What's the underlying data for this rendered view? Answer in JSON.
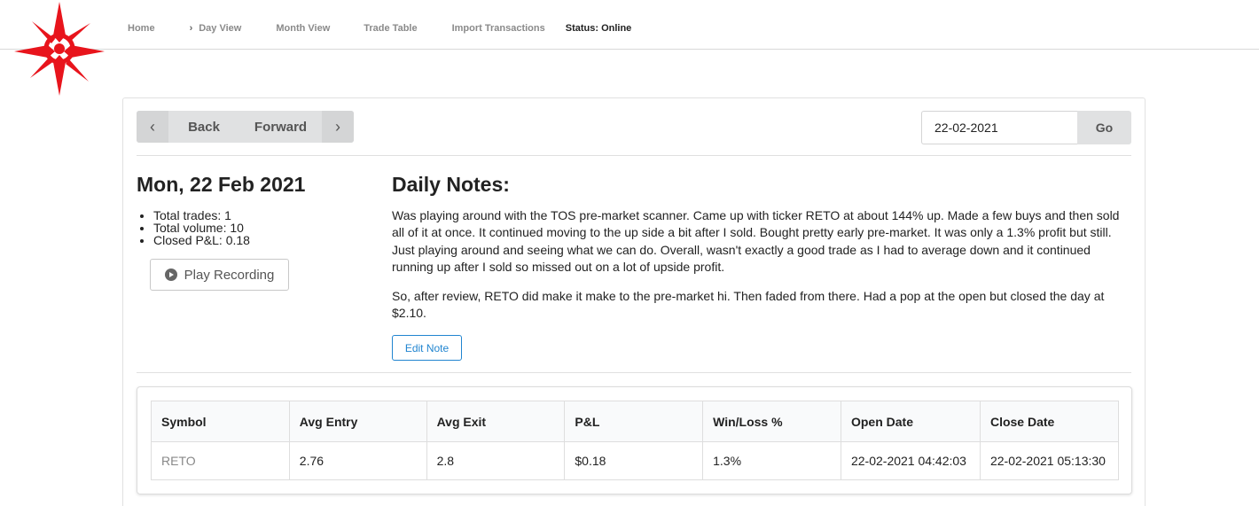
{
  "nav": {
    "items": [
      {
        "label": "Home"
      },
      {
        "label": "Day View"
      },
      {
        "label": "Month View"
      },
      {
        "label": "Trade Table"
      },
      {
        "label": "Import Transactions"
      }
    ],
    "status": "Status: Online"
  },
  "colors": {
    "logo": "#e8141c",
    "link_blue": "#2185d0"
  },
  "date_nav": {
    "back_label": "Back",
    "forward_label": "Forward",
    "date_value": "22-02-2021",
    "go_label": "Go"
  },
  "day": {
    "title": "Mon, 22 Feb 2021",
    "stats": [
      "Total trades: 1",
      "Total volume: 10",
      "Closed P&L: 0.18"
    ],
    "play_label": "Play Recording"
  },
  "notes": {
    "title": "Daily Notes:",
    "paragraphs": [
      "Was playing around with the TOS pre-market scanner. Came up with ticker RETO at about 144% up. Made a few buys and then sold all of it at once. It continued moving to the up side a bit after I sold. Bought pretty early pre-market. It was only a 1.3% profit but still. Just playing around and seeing what we can do. Overall, wasn't exactly a good trade as I had to average down and it continued running up after I sold so missed out on a lot of upside profit.",
      "So, after review, RETO did make it make to the pre-market hi. Then faded from there. Had a pop at the open but closed the day at $2.10."
    ],
    "edit_label": "Edit Note"
  },
  "trades": {
    "headers": [
      "Symbol",
      "Avg Entry",
      "Avg Exit",
      "P&L",
      "Win/Loss %",
      "Open Date",
      "Close Date"
    ],
    "rows": [
      [
        "RETO",
        "2.76",
        "2.8",
        "$0.18",
        "1.3%",
        "22-02-2021 04:42:03",
        "22-02-2021 05:13:30"
      ]
    ]
  }
}
